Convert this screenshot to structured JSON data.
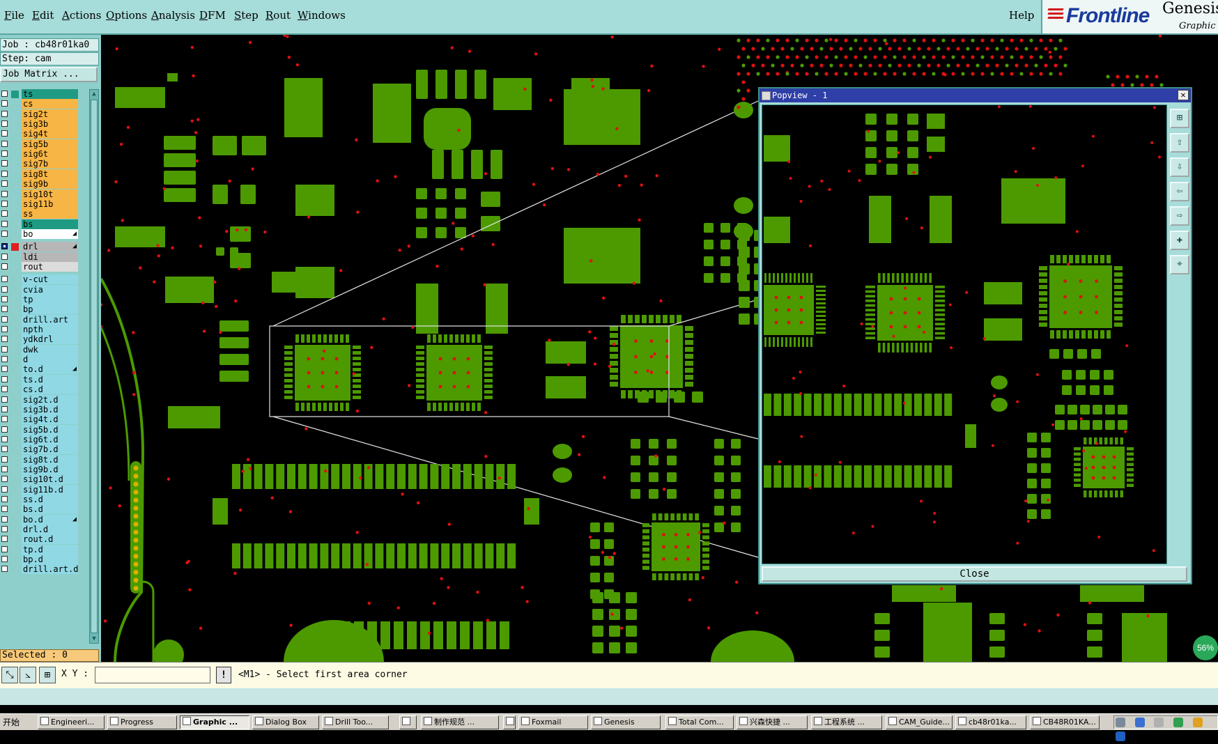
{
  "menu": [
    "File",
    "Edit",
    "Actions",
    "Options",
    "Analysis",
    "DFM",
    "Step",
    "Rout",
    "Windows"
  ],
  "help": "Help",
  "brand": {
    "logo": "Frontline",
    "product": "Genesis",
    "subtitle": "Graphic E"
  },
  "job": {
    "job_label": "Job : cb48r01ka0",
    "step_label": "Step: cam",
    "matrix_button": "Job Matrix ..."
  },
  "layers": [
    {
      "name": "ts",
      "color": "#1f9b84",
      "mark": "#1f9b84"
    },
    {
      "name": "cs",
      "color": "#f7b545"
    },
    {
      "name": "sig2t",
      "color": "#f7b545"
    },
    {
      "name": "sig3b",
      "color": "#f7b545"
    },
    {
      "name": "sig4t",
      "color": "#f7b545"
    },
    {
      "name": "sig5b",
      "color": "#f7b545"
    },
    {
      "name": "sig6t",
      "color": "#f7b545"
    },
    {
      "name": "sig7b",
      "color": "#f7b545"
    },
    {
      "name": "sig8t",
      "color": "#f7b545"
    },
    {
      "name": "sig9b",
      "color": "#f7b545"
    },
    {
      "name": "sig10t",
      "color": "#f7b545"
    },
    {
      "name": "sig11b",
      "color": "#f7b545"
    },
    {
      "name": "ss",
      "color": "#f7b545"
    },
    {
      "name": "bs",
      "color": "#1f9b84"
    },
    {
      "name": "bo",
      "color": "#ffffff",
      "flag": "◢"
    },
    {
      "name": "drl",
      "color": "#b7b7b7",
      "mark": "#e02020",
      "flag": "▣",
      "gap": true
    },
    {
      "name": "ldi",
      "color": "#b7b7b7"
    },
    {
      "name": "rout",
      "color": "#dcdcdc"
    },
    {
      "name": "v-cut",
      "color": "#8fd8e4",
      "gap": true
    },
    {
      "name": "cvia",
      "color": "#8fd8e4"
    },
    {
      "name": "tp",
      "color": "#8fd8e4"
    },
    {
      "name": "bp",
      "color": "#8fd8e4"
    },
    {
      "name": "drill.art",
      "color": "#8fd8e4"
    },
    {
      "name": "npth",
      "color": "#8fd8e4"
    },
    {
      "name": "ydkdrl",
      "color": "#8fd8e4"
    },
    {
      "name": "dwk",
      "color": "#8fd8e4"
    },
    {
      "name": "d",
      "color": "#8fd8e4"
    },
    {
      "name": "to.d",
      "color": "#8fd8e4",
      "flag": "◢"
    },
    {
      "name": "ts.d",
      "color": "#8fd8e4"
    },
    {
      "name": "cs.d",
      "color": "#8fd8e4"
    },
    {
      "name": "sig2t.d",
      "color": "#8fd8e4"
    },
    {
      "name": "sig3b.d",
      "color": "#8fd8e4"
    },
    {
      "name": "sig4t.d",
      "color": "#8fd8e4"
    },
    {
      "name": "sig5b.d",
      "color": "#8fd8e4"
    },
    {
      "name": "sig6t.d",
      "color": "#8fd8e4"
    },
    {
      "name": "sig7b.d",
      "color": "#8fd8e4"
    },
    {
      "name": "sig8t.d",
      "color": "#8fd8e4"
    },
    {
      "name": "sig9b.d",
      "color": "#8fd8e4"
    },
    {
      "name": "sig10t.d",
      "color": "#8fd8e4"
    },
    {
      "name": "sig11b.d",
      "color": "#8fd8e4"
    },
    {
      "name": "ss.d",
      "color": "#8fd8e4"
    },
    {
      "name": "bs.d",
      "color": "#8fd8e4"
    },
    {
      "name": "bo.d",
      "color": "#8fd8e4",
      "flag": "◢"
    },
    {
      "name": "drl.d",
      "color": "#8fd8e4"
    },
    {
      "name": "rout.d",
      "color": "#8fd8e4"
    },
    {
      "name": "tp.d",
      "color": "#8fd8e4"
    },
    {
      "name": "bp.d",
      "color": "#8fd8e4"
    },
    {
      "name": "drill.art.d",
      "color": "#8fd8e4"
    }
  ],
  "selected": "Selected : 0",
  "status": {
    "xy_label": "X Y :",
    "xy_value": "",
    "hint": "<M1> - Select first area corner"
  },
  "popview": {
    "title": "Popview - 1",
    "close_label": "Close"
  },
  "zoom_badge": "56%",
  "colors": {
    "pad": "#4c9a00",
    "drill": "#e01010",
    "bg": "#000000",
    "panel": "#8fcfcb"
  },
  "taskbar": {
    "start": "开始",
    "tasks": [
      "Engineeri...",
      "Progress",
      "Graphic ...",
      "Dialog Box",
      "Drill Too...",
      "",
      "制作规范 ...",
      "",
      "Foxmail",
      "Genesis",
      "Total Com...",
      "兴森快捷 ...",
      "工程系统 ...",
      "CAM_Guide...",
      "cb48r01ka...",
      "CB48R01KA..."
    ],
    "active_index": 2
  }
}
